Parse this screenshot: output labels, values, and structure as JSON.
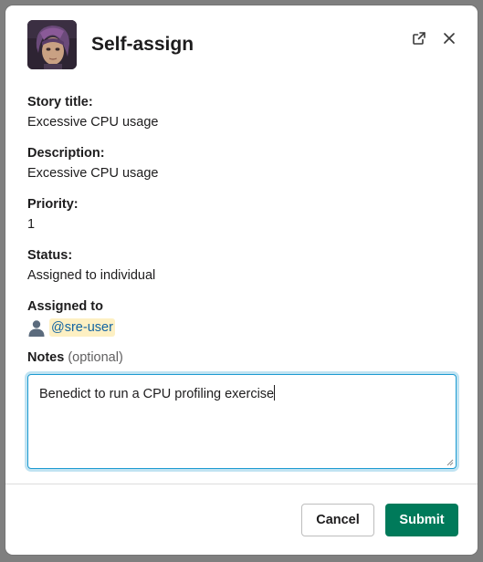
{
  "header": {
    "title": "Self-assign",
    "avatar_icon": "character-avatar",
    "open_icon": "open-external-icon",
    "close_icon": "close-icon"
  },
  "fields": {
    "story_title": {
      "label": "Story title:",
      "value": "Excessive CPU usage"
    },
    "description": {
      "label": "Description:",
      "value": "Excessive CPU usage"
    },
    "priority": {
      "label": "Priority:",
      "value": "1"
    },
    "status": {
      "label": "Status:",
      "value": "Assigned to individual"
    },
    "assigned_to": {
      "label": "Assigned to",
      "mention": "@sre-user",
      "icon": "user-silhouette-icon"
    }
  },
  "notes": {
    "label": "Notes",
    "optional": "(optional)",
    "value": "Benedict to run a CPU profiling exercise"
  },
  "footer": {
    "cancel_label": "Cancel",
    "submit_label": "Submit"
  },
  "colors": {
    "submit_bg": "#007a5a",
    "mention_bg": "#fdf0c3",
    "mention_text": "#1264a3",
    "focus_border": "#1d9bd1"
  }
}
